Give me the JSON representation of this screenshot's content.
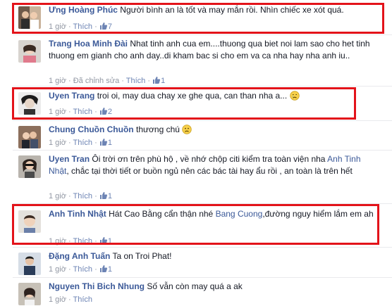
{
  "comments": [
    {
      "author": "Ưng Hoàng Phúc",
      "text": "Người bình an là tốt và may mắn rồi. Nhìn chiếc xe xót quá.",
      "time": "1 giờ",
      "like_label": "Thích",
      "like_count": "7"
    },
    {
      "author": "Trang Hoa Minh Đài",
      "text": "Nhat tinh anh cua em....thuong qua biet noi lam sao cho het tinh thuong em gianh cho anh day..di kham bac si cho em va ca nha hay nha anh iu..",
      "time": "1 giờ",
      "edited_label": "Đã chỉnh sửa",
      "like_label": "Thích",
      "like_count": "1"
    },
    {
      "author": "Uyen Trang",
      "text": "troi oi, may dua chay xe ghe qua, can than nha a...",
      "emoji": "crying-face",
      "time": "1 giờ",
      "like_label": "Thích",
      "like_count": "2"
    },
    {
      "author": "Chung Chuồn Chuồn",
      "text": "thương chú",
      "emoji": "frown-face",
      "time": "1 giờ",
      "like_label": "Thích",
      "like_count": "1"
    },
    {
      "author": "Uyen Tran",
      "text_before": "Ôi trời ơn trên phù hộ , về nhớ chộp citi kiểm tra toàn viện nha",
      "tag": "Anh Tinh Nhật",
      "text_after": ", chắc tại thời tiết or buồn ngủ nên các bác tài hay ẩu rồi , an toàn là trên hết",
      "time": "1 giờ",
      "like_label": "Thích",
      "like_count": "1"
    },
    {
      "author": "Anh Tinh Nhật",
      "text_before": "Hát Cao Bằng cẩn thận nhé",
      "tag": "Bang Cuong",
      "text_after": ",đường nguy hiểm lắm em ah",
      "time": "1 giờ",
      "like_label": "Thích",
      "like_count": "1"
    },
    {
      "author": "Đặng Anh Tuấn",
      "text": "Ta on Troi Phat!",
      "time": "1 giờ",
      "like_label": "Thích",
      "like_count": "1"
    },
    {
      "author": "Nguyen Thi Bich Nhung",
      "text": "Số vẫn còn may quá a ak",
      "time": "1 giờ",
      "like_label": "Thích"
    }
  ],
  "colors": {
    "link": "#3b5998",
    "meta": "#9197a3",
    "highlight": "#e3131a",
    "separator": "#e9eaed"
  }
}
